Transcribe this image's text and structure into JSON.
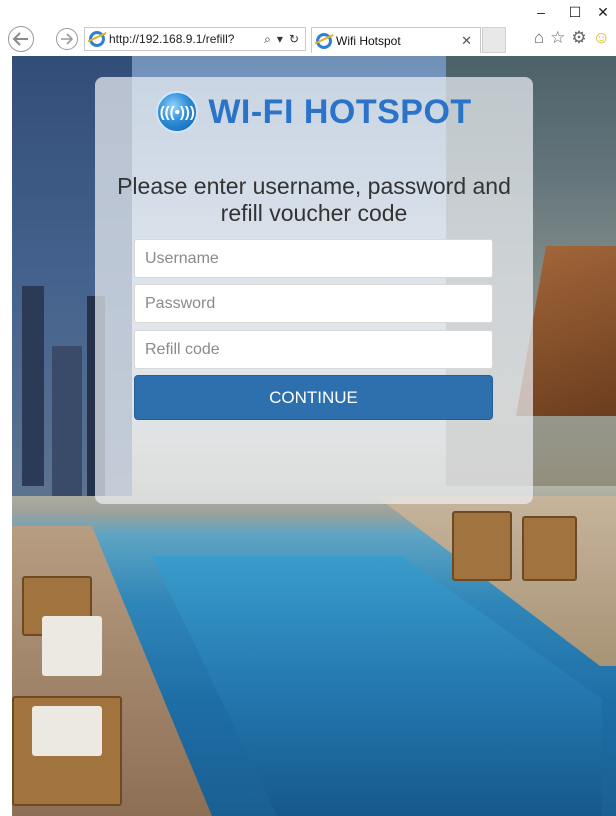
{
  "browser": {
    "url": "http://192.168.9.1/refill?",
    "tab_title": "Wifi Hotspot",
    "window_controls": {
      "minimize": "–",
      "maximize": "☐",
      "close": "✕"
    },
    "nav_icons": [
      "back-icon",
      "forward-icon"
    ],
    "toolbar_icons": [
      "home-icon",
      "favorites-star-icon",
      "settings-gear-icon",
      "smiley-feedback-icon"
    ]
  },
  "logo": {
    "badge": "(((•)))",
    "text": "WI-FI HOTSPOT"
  },
  "form": {
    "prompt": "Please enter username, password and refill voucher code",
    "username_placeholder": "Username",
    "password_placeholder": "Password",
    "refill_placeholder": "Refill code",
    "continue_label": "CONTINUE"
  },
  "colors": {
    "accent": "#2e6fad",
    "logo": "#2a73c8"
  }
}
